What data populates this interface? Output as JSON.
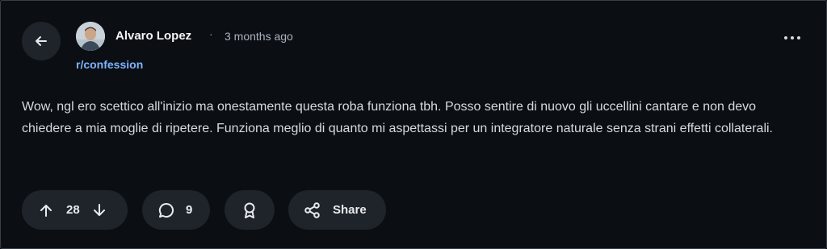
{
  "post": {
    "author": "Alvaro Lopez",
    "separator": "·",
    "time": "3 months ago",
    "community": "r/confession",
    "body": "Wow, ngl ero scettico all'inizio ma onestamente questa roba funziona tbh. Posso sentire di nuovo gli uccellini cantare e non devo chiedere a mia moglie di ripetere. Funziona meglio di quanto mi aspettassi per un integratore naturale senza strani effetti collaterali."
  },
  "actions": {
    "votes": "28",
    "comments": "9",
    "share_label": "Share"
  },
  "icons": {
    "back": "arrow-left-icon",
    "more": "more-horizontal-icon",
    "upvote": "arrow-up-icon",
    "downvote": "arrow-down-icon",
    "comment": "comment-bubble-icon",
    "award": "award-ribbon-icon",
    "share": "share-nodes-icon"
  },
  "colors": {
    "background": "#0b0f14",
    "surface": "#1f242a",
    "link": "#7fb3ff",
    "text": "#d7dadc"
  }
}
